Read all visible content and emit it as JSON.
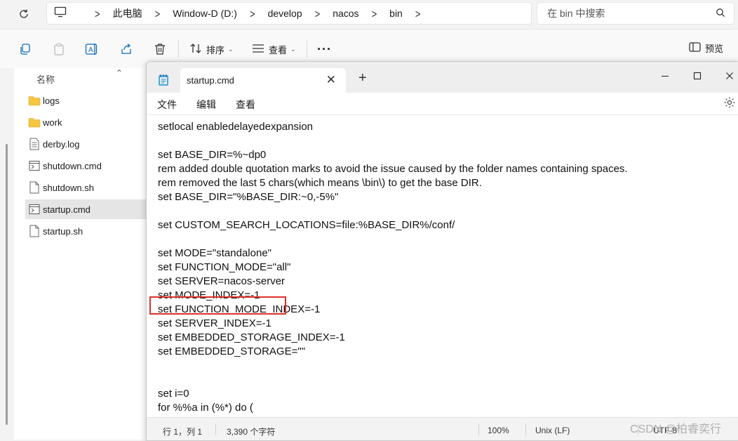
{
  "explorer": {
    "breadcrumbs": [
      "此电脑",
      "Window-D (D:)",
      "develop",
      "nacos",
      "bin"
    ],
    "search_placeholder": "在 bin 中搜索",
    "commands": {
      "sort": "排序",
      "view": "查看",
      "preview": "预览"
    },
    "column_header": "名称",
    "files": [
      {
        "name": "logs",
        "icon": "folder-icon",
        "selected": false
      },
      {
        "name": "work",
        "icon": "folder-icon",
        "selected": false
      },
      {
        "name": "derby.log",
        "icon": "text-file-icon",
        "selected": false
      },
      {
        "name": "shutdown.cmd",
        "icon": "cmd-file-icon",
        "selected": false
      },
      {
        "name": "shutdown.sh",
        "icon": "file-icon",
        "selected": false
      },
      {
        "name": "startup.cmd",
        "icon": "cmd-file-icon",
        "selected": true
      },
      {
        "name": "startup.sh",
        "icon": "file-icon",
        "selected": false
      }
    ]
  },
  "notepad": {
    "tab_title": "startup.cmd",
    "menu": [
      "文件",
      "编辑",
      "查看"
    ],
    "lines": [
      "setlocal enabledelayedexpansion",
      "",
      "set BASE_DIR=%~dp0",
      "rem added double quotation marks to avoid the issue caused by the folder names containing spaces.",
      "rem removed the last 5 chars(which means \\bin\\) to get the base DIR.",
      "set BASE_DIR=\"%BASE_DIR:~0,-5%\"",
      "",
      "set CUSTOM_SEARCH_LOCATIONS=file:%BASE_DIR%/conf/",
      "",
      "set MODE=\"standalone\"",
      "set FUNCTION_MODE=\"all\"",
      "set SERVER=nacos-server",
      "set MODE_INDEX=-1",
      "set FUNCTION_MODE_INDEX=-1",
      "set SERVER_INDEX=-1",
      "set EMBEDDED_STORAGE_INDEX=-1",
      "set EMBEDDED_STORAGE=\"\"",
      "",
      "",
      "set i=0",
      "for %%a in (%*) do ("
    ],
    "highlighted_line": "set MODE=\"standalone\"",
    "status": {
      "position": "行 1，列 1",
      "char_count": "3,390 个字符",
      "zoom": "100%",
      "line_ending": "Unix (LF)",
      "encoding": "UTF-8"
    }
  },
  "watermark": "CSDN @柏睿奕行",
  "colors": {
    "highlight_border": "#e0302b",
    "folder": "#f5c642",
    "accent": "#0f6cbd"
  }
}
